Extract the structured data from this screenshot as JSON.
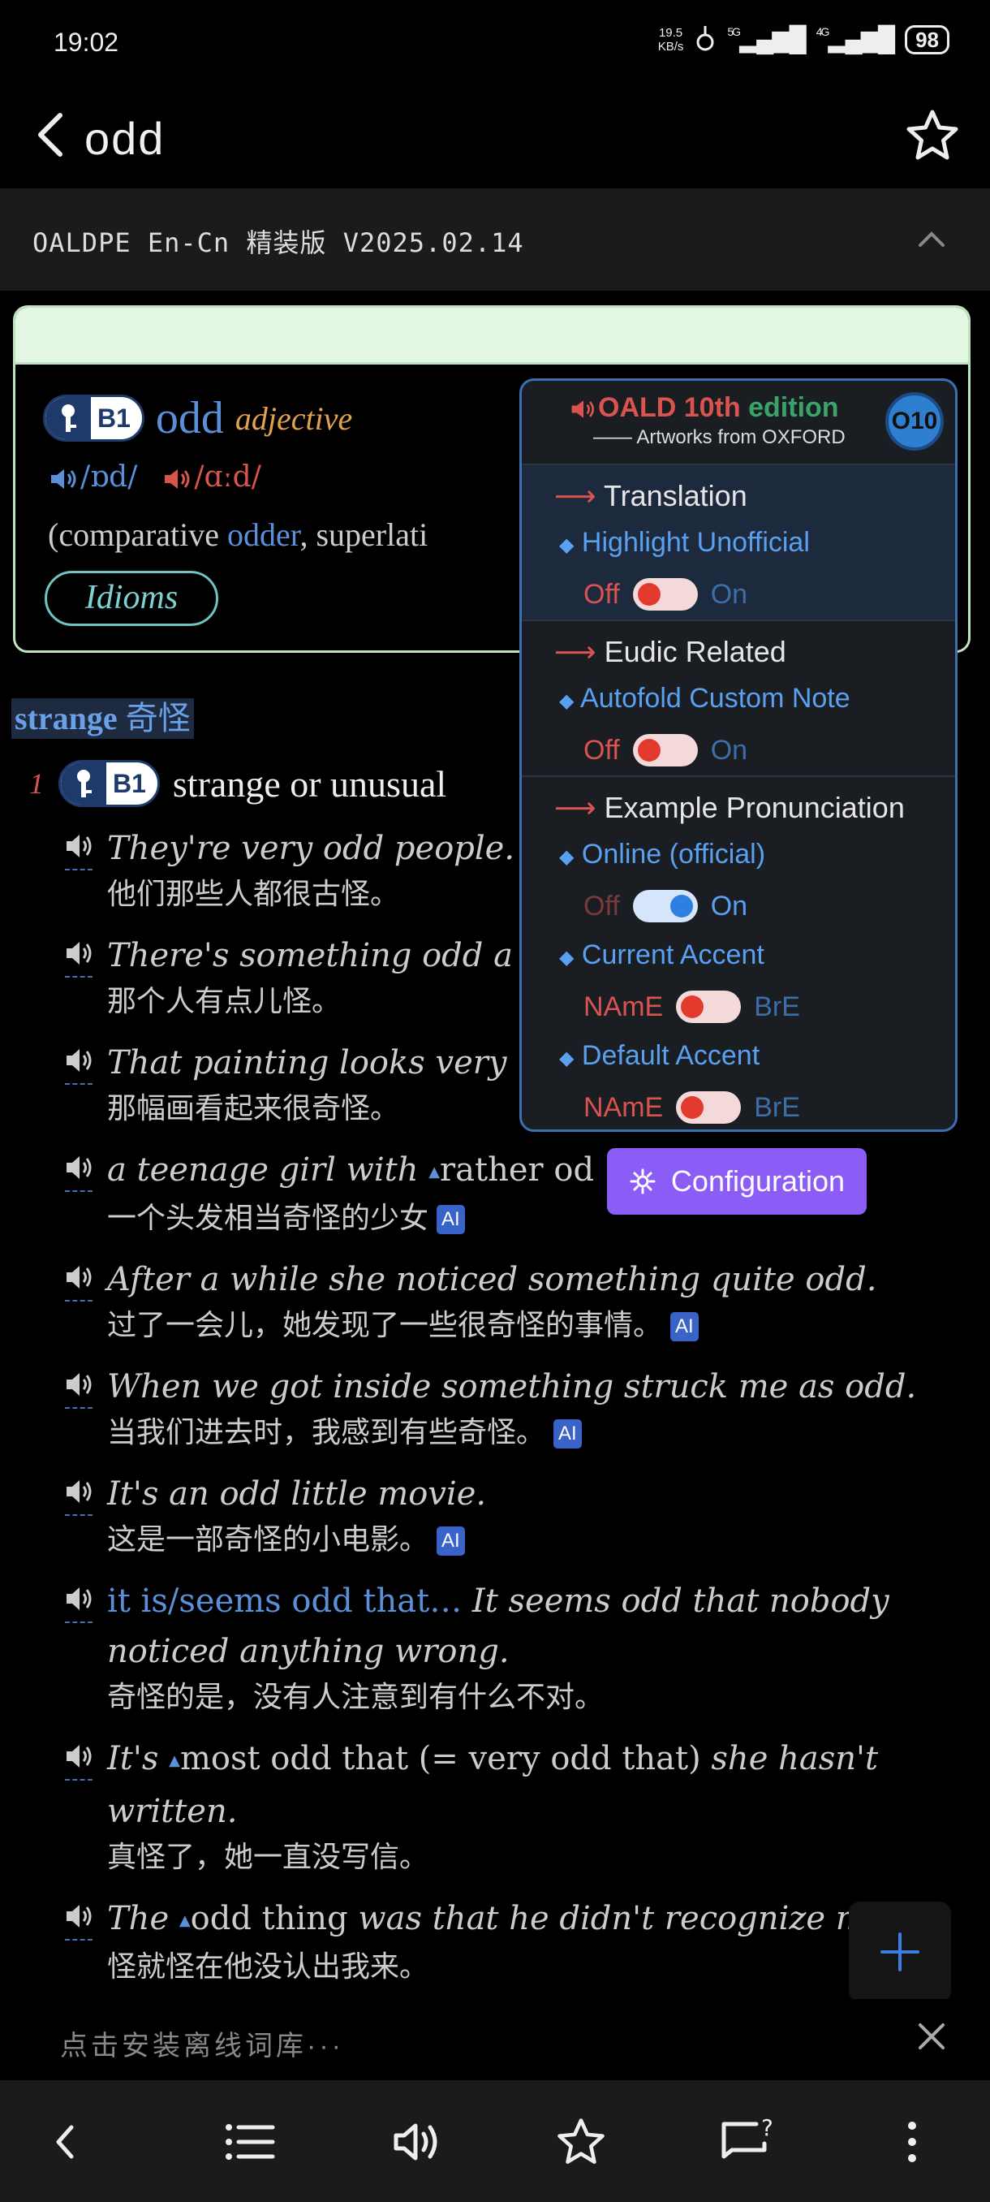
{
  "status": {
    "time": "19:02",
    "net_speed_top": "19.5",
    "net_speed_unit": "KB/s",
    "sig1": "5G",
    "sig2": "4G",
    "battery": "98"
  },
  "appbar": {
    "word": "odd"
  },
  "dict": {
    "title": "OALDPE En-Cn 精装版 V2025.02.14"
  },
  "entry": {
    "level": "B1",
    "headword": "odd",
    "pos": "adjective",
    "pron_br": "/ɒd/",
    "pron_am": "/ɑːd/",
    "forms_prefix": "(comparative ",
    "forms_word1": "odder",
    "forms_mid": ", superlati",
    "idioms": "Idioms"
  },
  "sense": {
    "shortcut_en": "strange",
    "shortcut_zh": "奇怪",
    "number": "1",
    "level": "B1",
    "definition": "strange or unusual"
  },
  "examples": [
    {
      "en": "They're very odd people.",
      "zh": "他们那些人都很古怪。"
    },
    {
      "en": "There's something odd a",
      "zh": "那个人有点儿怪。"
    },
    {
      "en": "That painting looks very",
      "zh": "那幅画看起来很奇怪。"
    },
    {
      "en_a": "a teenage girl with ",
      "en_b": "rather od",
      "zh": "一个头发相当奇怪的少女",
      "ai": "AI"
    },
    {
      "en": "After a while she noticed something quite odd.",
      "zh": "过了一会儿，她发现了一些很奇怪的事情。",
      "ai": "AI"
    },
    {
      "en": "When we got inside something struck me as odd.",
      "zh": "当我们进去时，我感到有些奇怪。",
      "ai": "AI"
    },
    {
      "en": "It's an odd little movie.",
      "zh": "这是一部奇怪的小电影。",
      "ai": "AI"
    },
    {
      "pattern": "it is/seems odd that…",
      "en": " It seems odd that nobody noticed anything wrong.",
      "zh": "奇怪的是，没有人注意到有什么不对。"
    },
    {
      "en_a": "It's ",
      "en_b": "most odd that (= very odd that)",
      "en_c": " she hasn't written.",
      "zh": "真怪了，她一直没写信。"
    },
    {
      "en_a": "The ",
      "en_b": "odd thing",
      "en_c": " was that he didn't recognize me.",
      "zh": "怪就怪在他没认出我来。"
    }
  ],
  "popup": {
    "title_a": "OALD 10th ",
    "title_b": "edition",
    "subtitle": "—— Artworks from OXFORD",
    "badge": "O10",
    "sections": [
      {
        "title": "Translation",
        "option": "Highlight Unofficial",
        "left": "Off",
        "right": "On"
      },
      {
        "title": "Eudic Related",
        "option": "Autofold Custom Note",
        "left": "Off",
        "right": "On"
      },
      {
        "title": "Example Pronunciation",
        "option": "Online (official)",
        "left": "Off",
        "right": "On",
        "option2": "Current Accent",
        "left2": "NAmE",
        "right2": "BrE",
        "option3": "Default Accent",
        "left3": "NAmE",
        "right3": "BrE"
      }
    ]
  },
  "config_button": "Configuration",
  "install_bar": {
    "text": "点击安装离线词库···"
  },
  "colors": {
    "accent_blue": "#5b8fd8",
    "red": "#d9534f",
    "purple": "#8b5cf6",
    "green_band": "#e3f5e3"
  }
}
